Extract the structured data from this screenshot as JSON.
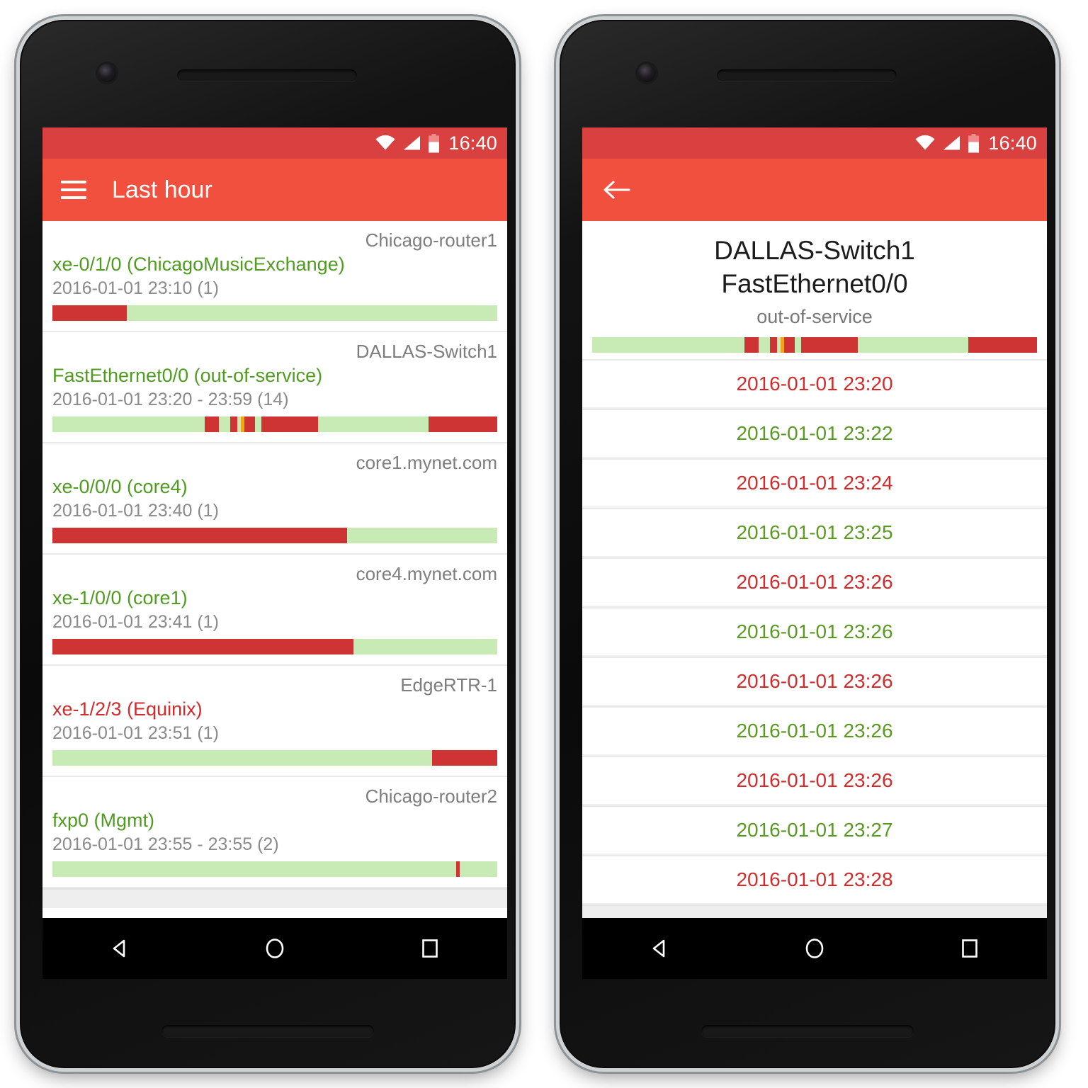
{
  "status_bar": {
    "time": "16:40",
    "icons": [
      "wifi-icon",
      "cellular-signal-icon",
      "battery-low-icon"
    ]
  },
  "colors": {
    "toolbar": "#f2503f",
    "status_bar": "#d94141",
    "up_green": "#4f9c20",
    "down_red": "#d22b2b",
    "bar_green": "#c8eab4",
    "bar_red": "#cf3434",
    "bar_orange": "#f0a51e",
    "host_gray": "#7d7d7d"
  },
  "left_phone": {
    "toolbar": {
      "menu_icon": "hamburger-menu-icon",
      "title": "Last hour"
    },
    "alerts": [
      {
        "host": "Chicago-router1",
        "interface": "xe-0/1/0 (ChicagoMusicExchange)",
        "state": "up",
        "time": "2016-01-01 23:10 (1)",
        "segments": [
          {
            "color": "red",
            "start": 0.0,
            "end": 0.167
          },
          {
            "color": "green",
            "start": 0.167,
            "end": 1.0
          }
        ]
      },
      {
        "host": "DALLAS-Switch1",
        "interface": "FastEthernet0/0 (out-of-service)",
        "state": "up",
        "time": "2016-01-01 23:20 - 23:59 (14)",
        "segments": [
          {
            "color": "green",
            "start": 0.0,
            "end": 0.342
          },
          {
            "color": "red",
            "start": 0.342,
            "end": 0.375
          },
          {
            "color": "green",
            "start": 0.375,
            "end": 0.4
          },
          {
            "color": "red",
            "start": 0.4,
            "end": 0.416
          },
          {
            "color": "green",
            "start": 0.416,
            "end": 0.424
          },
          {
            "color": "orange",
            "start": 0.424,
            "end": 0.431
          },
          {
            "color": "red",
            "start": 0.431,
            "end": 0.456
          },
          {
            "color": "green",
            "start": 0.456,
            "end": 0.47
          },
          {
            "color": "red",
            "start": 0.47,
            "end": 0.597
          },
          {
            "color": "green",
            "start": 0.597,
            "end": 0.845
          },
          {
            "color": "red",
            "start": 0.845,
            "end": 1.0
          }
        ]
      },
      {
        "host": "core1.mynet.com",
        "interface": "xe-0/0/0 (core4)",
        "state": "up",
        "time": "2016-01-01 23:40 (1)",
        "segments": [
          {
            "color": "red",
            "start": 0.0,
            "end": 0.662
          },
          {
            "color": "green",
            "start": 0.662,
            "end": 1.0
          }
        ]
      },
      {
        "host": "core4.mynet.com",
        "interface": "xe-1/0/0 (core1)",
        "state": "up",
        "time": "2016-01-01 23:41 (1)",
        "segments": [
          {
            "color": "red",
            "start": 0.0,
            "end": 0.677
          },
          {
            "color": "green",
            "start": 0.677,
            "end": 1.0
          }
        ]
      },
      {
        "host": "EdgeRTR-1",
        "interface": "xe-1/2/3 (Equinix)",
        "state": "down",
        "time": "2016-01-01 23:51 (1)",
        "segments": [
          {
            "color": "green",
            "start": 0.0,
            "end": 0.853
          },
          {
            "color": "red",
            "start": 0.853,
            "end": 1.0
          }
        ]
      },
      {
        "host": "Chicago-router2",
        "interface": "fxp0 (Mgmt)",
        "state": "up",
        "time": "2016-01-01 23:55 - 23:55 (2)",
        "segments": [
          {
            "color": "green",
            "start": 0.0,
            "end": 0.907
          },
          {
            "color": "red",
            "start": 0.907,
            "end": 0.915
          },
          {
            "color": "green",
            "start": 0.915,
            "end": 1.0
          }
        ]
      }
    ]
  },
  "right_phone": {
    "toolbar": {
      "back_icon": "back-arrow-icon"
    },
    "detail": {
      "device": "DALLAS-Switch1",
      "interface": "FastEthernet0/0",
      "description": "out-of-service",
      "segments": [
        {
          "color": "green",
          "start": 0.0,
          "end": 0.342
        },
        {
          "color": "red",
          "start": 0.342,
          "end": 0.375
        },
        {
          "color": "green",
          "start": 0.375,
          "end": 0.4
        },
        {
          "color": "red",
          "start": 0.4,
          "end": 0.416
        },
        {
          "color": "green",
          "start": 0.416,
          "end": 0.424
        },
        {
          "color": "orange",
          "start": 0.424,
          "end": 0.431
        },
        {
          "color": "red",
          "start": 0.431,
          "end": 0.456
        },
        {
          "color": "green",
          "start": 0.456,
          "end": 0.47
        },
        {
          "color": "red",
          "start": 0.47,
          "end": 0.597
        },
        {
          "color": "green",
          "start": 0.597,
          "end": 0.845
        },
        {
          "color": "red",
          "start": 0.845,
          "end": 1.0
        }
      ],
      "events": [
        {
          "timestamp": "2016-01-01 23:20",
          "state": "down"
        },
        {
          "timestamp": "2016-01-01 23:22",
          "state": "up"
        },
        {
          "timestamp": "2016-01-01 23:24",
          "state": "down"
        },
        {
          "timestamp": "2016-01-01 23:25",
          "state": "up"
        },
        {
          "timestamp": "2016-01-01 23:26",
          "state": "down"
        },
        {
          "timestamp": "2016-01-01 23:26",
          "state": "up"
        },
        {
          "timestamp": "2016-01-01 23:26",
          "state": "down"
        },
        {
          "timestamp": "2016-01-01 23:26",
          "state": "up"
        },
        {
          "timestamp": "2016-01-01 23:26",
          "state": "down"
        },
        {
          "timestamp": "2016-01-01 23:27",
          "state": "up"
        },
        {
          "timestamp": "2016-01-01 23:28",
          "state": "down"
        }
      ]
    }
  },
  "nav_bar": {
    "buttons": [
      "back-nav-icon",
      "home-nav-icon",
      "recents-nav-icon"
    ]
  }
}
